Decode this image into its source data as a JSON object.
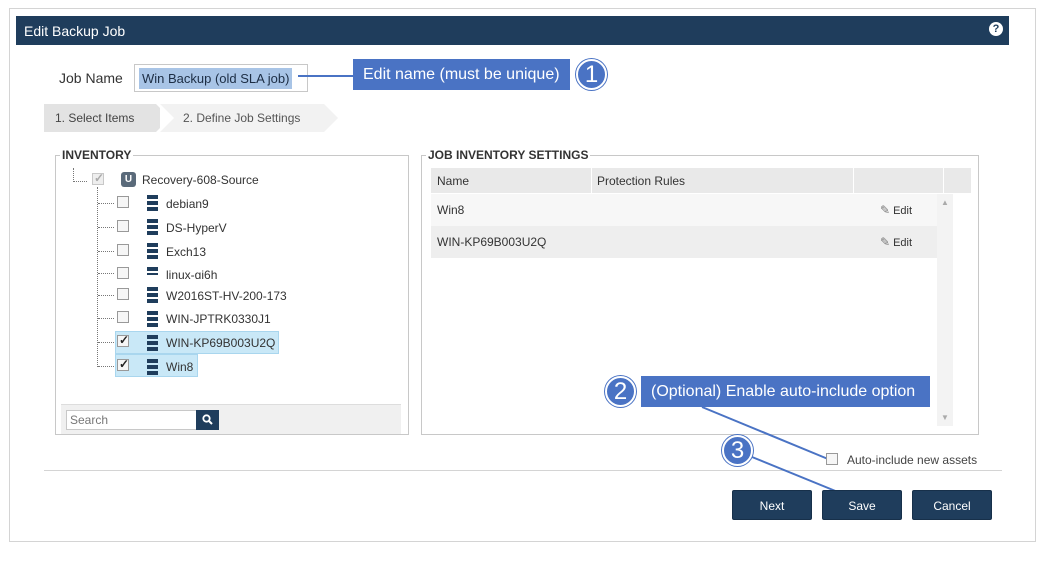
{
  "dialog": {
    "title": "Edit Backup Job",
    "help_icon": "?"
  },
  "job_name": {
    "label": "Job Name",
    "value": "Win Backup (old SLA job)"
  },
  "wizard": {
    "steps": [
      "1. Select Items",
      "2. Define Job Settings"
    ],
    "active_step": 0
  },
  "inventory": {
    "legend": "INVENTORY",
    "root": {
      "label": "Recovery-608-Source",
      "icon_text": "U",
      "checked": true,
      "disabled": true
    },
    "items": [
      {
        "label": "debian9",
        "checked": false
      },
      {
        "label": "DS-HyperV",
        "checked": false
      },
      {
        "label": "Exch13",
        "checked": false
      },
      {
        "label": "linux-gi6h",
        "checked": false
      },
      {
        "label": "W2016ST-HV-200-173",
        "checked": false
      },
      {
        "label": "WIN-JPTRK0330J1",
        "checked": false
      },
      {
        "label": "WIN-KP69B003U2Q",
        "checked": true
      },
      {
        "label": "Win8",
        "checked": true
      }
    ],
    "search_placeholder": "Search"
  },
  "job_inventory": {
    "legend": "JOB INVENTORY SETTINGS",
    "columns": [
      "Name",
      "Protection Rules"
    ],
    "rows": [
      {
        "name": "Win8",
        "protection_rules": "",
        "edit_label": "Edit"
      },
      {
        "name": "WIN-KP69B003U2Q",
        "protection_rules": "",
        "edit_label": "Edit"
      }
    ]
  },
  "auto_include": {
    "label": "Auto-include new assets",
    "checked": false
  },
  "buttons": {
    "next": "Next",
    "save": "Save",
    "cancel": "Cancel"
  },
  "callouts": [
    {
      "number": "1",
      "text": "Edit name (must be unique)"
    },
    {
      "number": "2",
      "text": "(Optional) Enable auto-include option"
    },
    {
      "number": "3",
      "text": ""
    }
  ],
  "colors": {
    "title_bar": "#1f3d5c",
    "button": "#1f3d5c",
    "callout": "#4a73c4",
    "selection": "#c9e8f7"
  }
}
